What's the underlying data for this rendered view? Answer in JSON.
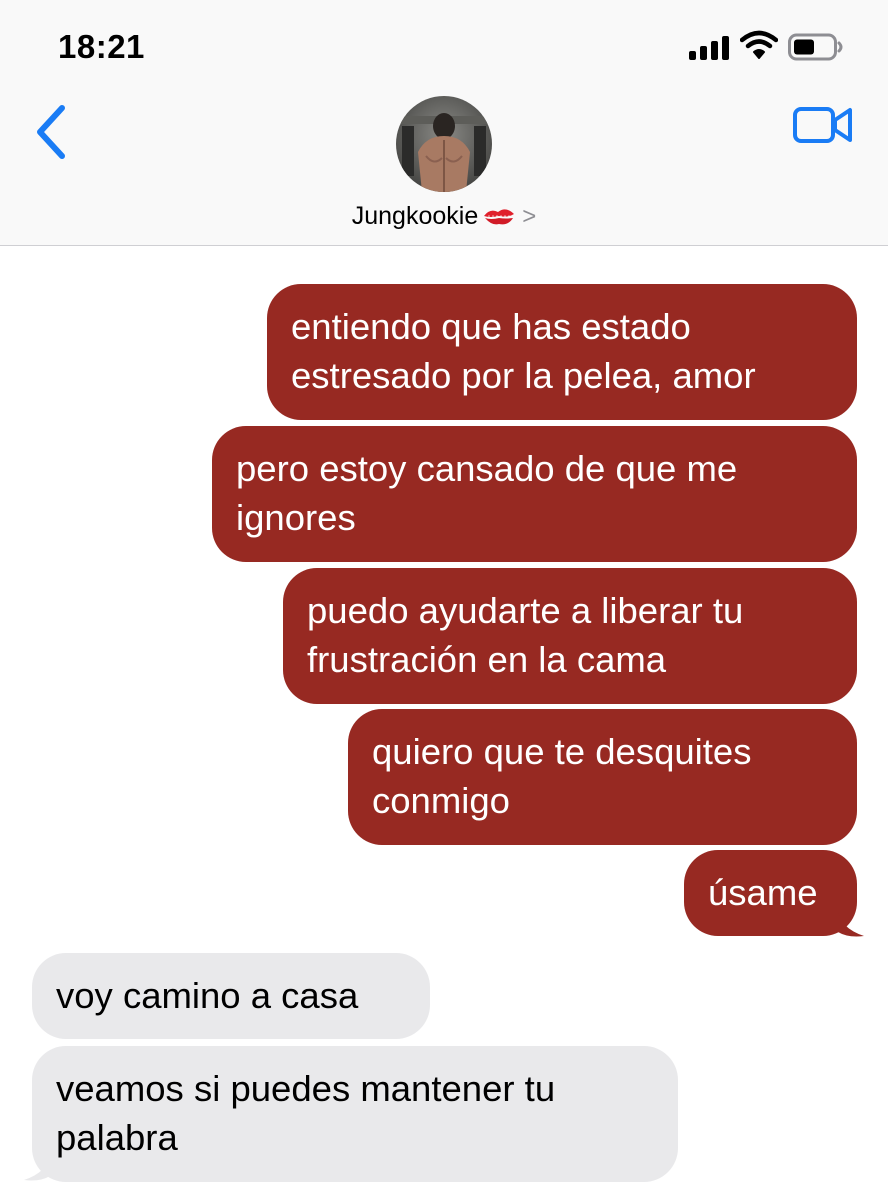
{
  "status_bar": {
    "time": "18:21"
  },
  "header": {
    "contact_name": "Jungkookie",
    "contact_emoji": "kiss-mark-icon",
    "chevron": ">"
  },
  "messages": [
    {
      "direction": "sent",
      "text": "entiendo que has estado\nestresado por la pelea, amor"
    },
    {
      "direction": "sent",
      "text": "pero estoy cansado de que me\nignores"
    },
    {
      "direction": "sent",
      "text": "puedo ayudarte a liberar tu\nfrustración en la cama"
    },
    {
      "direction": "sent",
      "text": "quiero que te desquites\nconmigo"
    },
    {
      "direction": "sent",
      "text": "úsame"
    },
    {
      "direction": "received",
      "text": "voy camino a casa"
    },
    {
      "direction": "received",
      "text": "veamos si puedes mantener tu\npalabra"
    }
  ],
  "colors": {
    "sent_bubble": "#972922",
    "received_bubble": "#e9e9eb",
    "accent": "#1a7cf5"
  }
}
